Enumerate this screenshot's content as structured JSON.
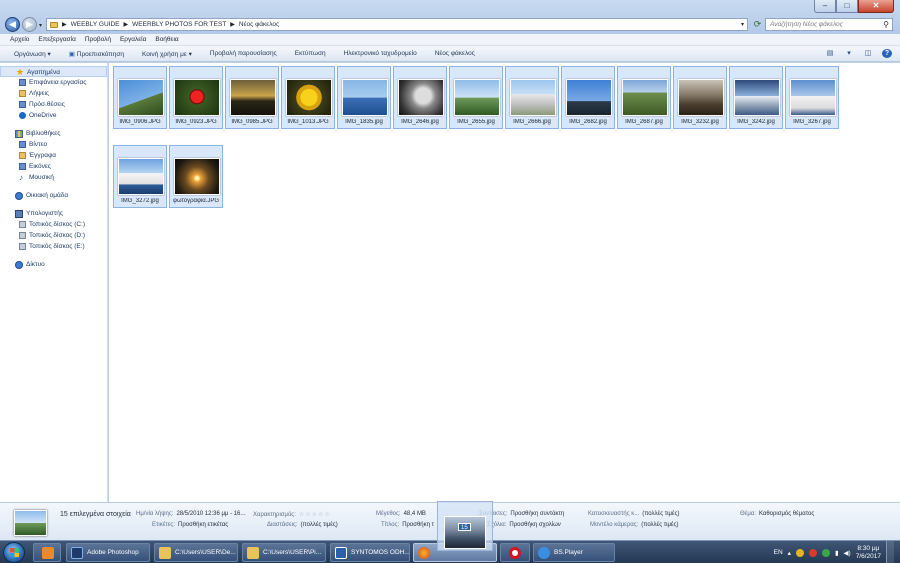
{
  "window": {
    "minimize": "–",
    "maximize": "□",
    "close": "✕"
  },
  "address": {
    "crumbs": [
      "WEEBLY GUIDE",
      "WEERBLY PHOTOS FOR TEST",
      "Νέος φάκελος"
    ],
    "search_placeholder": "Αναζήτηση Νέος φάκελος"
  },
  "menu": [
    "Αρχείο",
    "Επεξεργασία",
    "Προβολή",
    "Εργαλεία",
    "Βοήθεια"
  ],
  "toolbar": [
    "Οργάνωση ▾",
    "Προεπισκόπηση",
    "Κοινή χρήση με ▾",
    "Προβολή παρουσίασης",
    "Εκτύπωση",
    "Ηλεκτρονικό ταχυδρομείο",
    "Νέος φάκελος"
  ],
  "nav": {
    "favorites": "Αγαπημένα",
    "fav_items": [
      "Επιφάνεια εργασίας",
      "Λήψεις",
      "Πρόσ.θέσεις",
      "OneDrive"
    ],
    "libraries": "Βιβλιοθήκες",
    "lib_items": [
      "Βίντεο",
      "Έγγραφα",
      "Εικόνες",
      "Μουσική"
    ],
    "homegroup": "Οικιακή ομάδα",
    "computer": "Υπολογιστής",
    "drives": [
      "Τοπικός δίσκος (C:)",
      "Τοπικός δίσκος (D:)",
      "Τοπικός δίσκος (E:)"
    ],
    "network": "Δίκτυο"
  },
  "files": [
    "IMG_0906.JPG",
    "IMG_0923.JPG",
    "IMG_0985.JPG",
    "IMG_1013.JPG",
    "IMG_1835.jpg",
    "IMG_2646.jpg",
    "IMG_2655.jpg",
    "IMG_2666.jpg",
    "IMG_2682.jpg",
    "IMG_2687.jpg",
    "IMG_3232.jpg",
    "IMG_3242.jpg",
    "IMG_3267.jpg",
    "IMG_3272.jpg",
    "φωτογραφία.JPG"
  ],
  "details": {
    "count": "15 επιλεγμένα στοιχεία",
    "date_k": "Ημ/νία λήψης:",
    "date_v": "28/5/2010 12:36 μμ - 16...",
    "tags_k": "Ετικέτες:",
    "tags_v": "Προσθήκη ετικέτας",
    "rating_k": "Χαρακτηρισμός:",
    "rating_v": "☆☆☆☆☆",
    "dims_k": "Διαστάσεις:",
    "dims_v": "(πολλές τιμές)",
    "size_k": "Μέγεθος:",
    "size_v": "48,4 MB",
    "title_k": "Τίτλος:",
    "title_v": "Προσθήκη τ",
    "authors_k": "Συντάκτες:",
    "authors_v": "Προσθήκη συντάκτη",
    "comments_k": "Σχόλια:",
    "comments_v": "Προσθήκη σχολίων",
    "maker_k": "Κατασκευαστής κ...",
    "maker_v": "(πολλές τιμές)",
    "model_k": "Μοντέλο κάμερας:",
    "model_v": "(πολλές τιμές)",
    "subject_k": "Θέμα:",
    "subject_v": "Καθορισμός θέματος"
  },
  "drag": {
    "badge": "15"
  },
  "taskbar": {
    "apps": [
      "",
      "Adobe Photoshop",
      "C:\\Users\\USER\\De...",
      "C:\\Users\\USER\\Pi...",
      "SYNTOMOS ODH...",
      "",
      "",
      "BS.Player"
    ],
    "lang": "EN",
    "time": "8:30 μμ",
    "date": "7/6/2017"
  }
}
